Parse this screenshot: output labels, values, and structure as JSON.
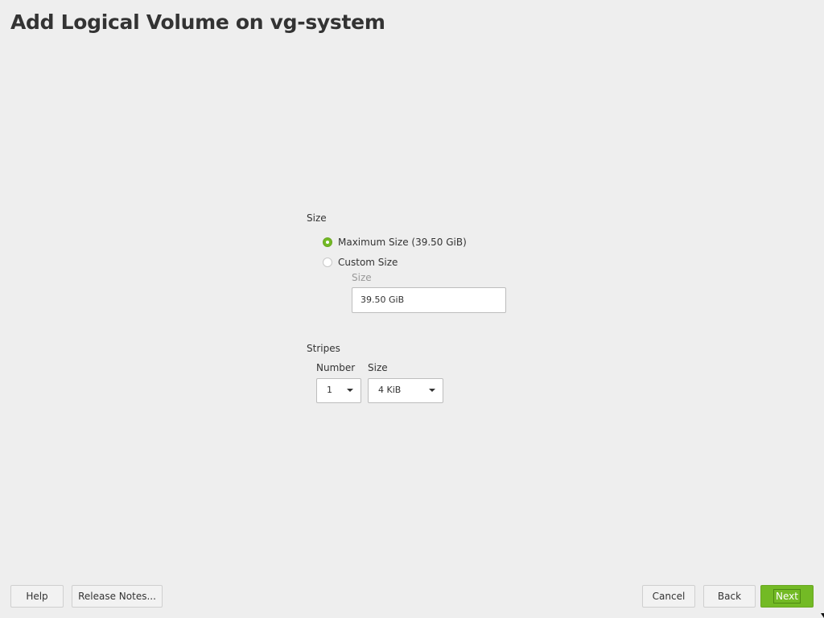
{
  "window": {
    "title": "Add Logical Volume on vg-system"
  },
  "size_section": {
    "label": "Size",
    "options": [
      {
        "label": "Maximum Size (39.50 GiB)",
        "selected": true
      },
      {
        "label": "Custom Size",
        "selected": false
      }
    ],
    "custom_size_label": "Size",
    "custom_size_value": "39.50 GiB"
  },
  "stripes_section": {
    "label": "Stripes",
    "number_label": "Number",
    "number_value": "1",
    "size_label": "Size",
    "size_value": "4 KiB"
  },
  "footer": {
    "help_label": "Help",
    "release_notes_label": "Release Notes...",
    "cancel_label": "Cancel",
    "back_label": "Back",
    "next_label": "Next"
  },
  "colors": {
    "accent": "#73ba25",
    "background": "#eeeeee",
    "text": "#333333",
    "disabled_text": "#999999"
  }
}
